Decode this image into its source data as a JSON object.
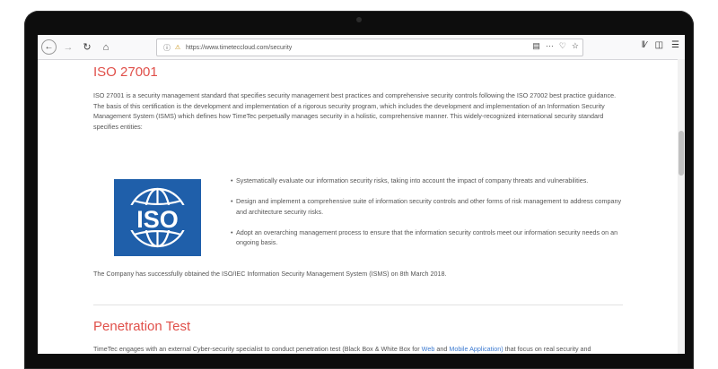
{
  "browser": {
    "url": "https://www.timeteccloud.com/security"
  },
  "page": {
    "iso_heading": "ISO 27001",
    "iso_intro": "ISO 27001 is a security management standard that specifies security management best practices and comprehensive security controls following the ISO 27002 best practice guidance. The basis of this certification is the development and implementation of a rigorous security program, which includes the development and implementation of an Information Security Management System (ISMS) which defines how TimeTec perpetually manages security in a holistic, comprehensive manner. This widely-recognized international security standard specifies entities:",
    "iso_logo_text": "ISO",
    "bullets": [
      "Systematically evaluate our information security risks, taking into account the impact of company threats and vulnerabilities.",
      "Design and implement a comprehensive suite of information security controls and other forms of risk management to address company and architecture security risks.",
      "Adopt an overarching management process to ensure that the information security controls meet our information security needs on an ongoing basis."
    ],
    "obtained_text": "The Company has successfully obtained the ISO/IEC Information Security Management System (ISMS) on 8th March 2018.",
    "pen_heading": "Penetration Test",
    "pen_text_1": "TimeTec engages with an external Cyber-security specialist to conduct penetration test (Black Box & White Box for ",
    "pen_link_web": "Web",
    "pen_text_2": " and ",
    "pen_link_mobile": "Mobile Application)",
    "pen_text_3": " that focus on real security and compliance problems for TimeTec Cloud System."
  },
  "colors": {
    "heading_red": "#e0504a",
    "iso_blue": "#1f5faa",
    "link_blue": "#3d7bd1"
  }
}
